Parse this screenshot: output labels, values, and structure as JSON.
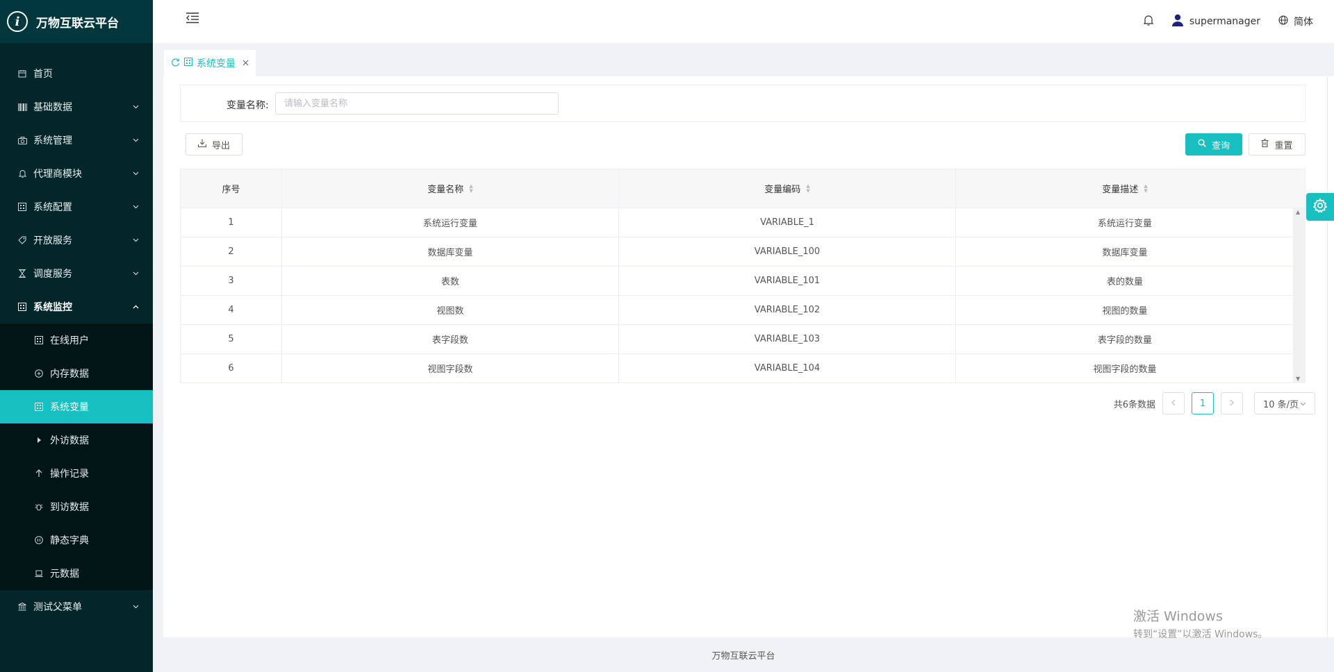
{
  "app": {
    "title": "万物互联云平台",
    "logo_glyph": "i"
  },
  "header": {
    "user": "supermanager",
    "language": "简体"
  },
  "sidebar": {
    "items": [
      {
        "label": "首页"
      },
      {
        "label": "基础数据"
      },
      {
        "label": "系统管理"
      },
      {
        "label": "代理商模块"
      },
      {
        "label": "系统配置"
      },
      {
        "label": "开放服务"
      },
      {
        "label": "调度服务"
      },
      {
        "label": "系统监控"
      }
    ],
    "submenu": [
      {
        "label": "在线用户"
      },
      {
        "label": "内存数据"
      },
      {
        "label": "系统变量"
      },
      {
        "label": "外访数据"
      },
      {
        "label": "操作记录"
      },
      {
        "label": "到访数据"
      },
      {
        "label": "静态字典"
      },
      {
        "label": "元数据"
      }
    ],
    "last_item": {
      "label": "测试父菜单"
    }
  },
  "tabs": [
    {
      "label": "系统变量"
    }
  ],
  "search": {
    "label": "变量名称:",
    "placeholder": "请输入变量名称",
    "value": ""
  },
  "toolbar": {
    "export_label": "导出",
    "query_label": "查询",
    "reset_label": "重置"
  },
  "table": {
    "headers": [
      "序号",
      "变量名称",
      "变量编码",
      "变量描述"
    ],
    "rows": [
      [
        "1",
        "系统运行变量",
        "VARIABLE_1",
        "系统运行变量"
      ],
      [
        "2",
        "数据库变量",
        "VARIABLE_100",
        "数据库变量"
      ],
      [
        "3",
        "表数",
        "VARIABLE_101",
        "表的数量"
      ],
      [
        "4",
        "视图数",
        "VARIABLE_102",
        "视图的数量"
      ],
      [
        "5",
        "表字段数",
        "VARIABLE_103",
        "表字段的数量"
      ],
      [
        "6",
        "视图字段数",
        "VARIABLE_104",
        "视图字段的数量"
      ]
    ]
  },
  "pagination": {
    "total_text": "共6条数据",
    "current_page": "1",
    "page_size": "10 条/页"
  },
  "watermark": {
    "title": "激活 Windows",
    "subtitle": "转到“设置”以激活 Windows。"
  },
  "footer": {
    "text": "万物互联云平台"
  },
  "colors": {
    "accent": "#17bfc0",
    "sidebar_bg": "#03262a",
    "submenu_bg": "#011416"
  }
}
